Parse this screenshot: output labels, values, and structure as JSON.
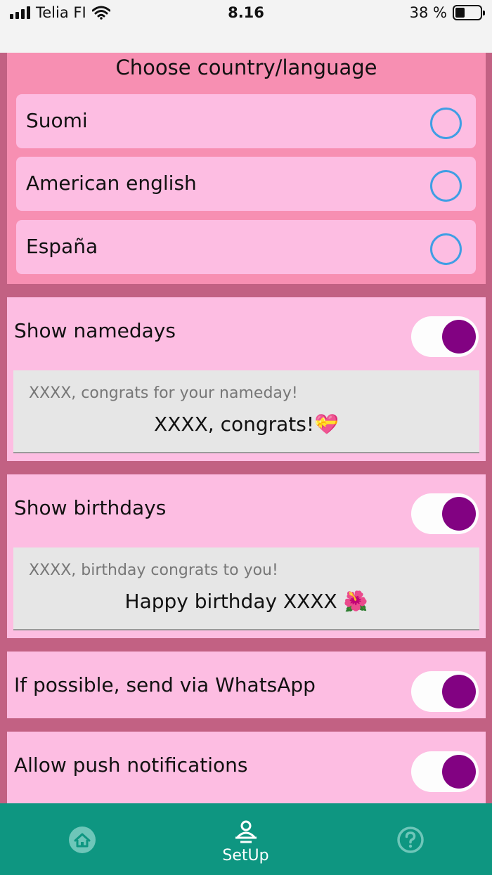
{
  "status_bar": {
    "carrier": "Telia FI",
    "time": "8.16",
    "battery_percent": "38 %"
  },
  "language_section": {
    "title": "Choose country/language",
    "options": [
      {
        "label": "Suomi",
        "selected": false
      },
      {
        "label": "American english",
        "selected": false
      },
      {
        "label": "España",
        "selected": false
      }
    ]
  },
  "namedays": {
    "label": "Show namedays",
    "enabled": true,
    "message_placeholder": "XXXX, congrats for your nameday!",
    "message_value": "XXXX, congrats!💝"
  },
  "birthdays": {
    "label": "Show birthdays",
    "enabled": true,
    "message_placeholder": "XXXX, birthday congrats to you!",
    "message_value": "Happy birthday XXXX 🌺"
  },
  "whatsapp": {
    "label": "If possible, send via WhatsApp",
    "enabled": true
  },
  "push": {
    "label": "Allow push notifications",
    "enabled": true
  },
  "bottom_nav": {
    "items": [
      {
        "icon": "home-icon",
        "label": ""
      },
      {
        "icon": "setup-person-icon",
        "label": "SetUp"
      },
      {
        "icon": "help-icon",
        "label": ""
      }
    ]
  },
  "colors": {
    "section_bg": "#f78fb2",
    "card_bg": "#fdbde2",
    "page_bg": "#c26183",
    "toggle_knob": "#820282",
    "radio_border": "#3f9ee4",
    "nav_bg": "#0e9681"
  }
}
